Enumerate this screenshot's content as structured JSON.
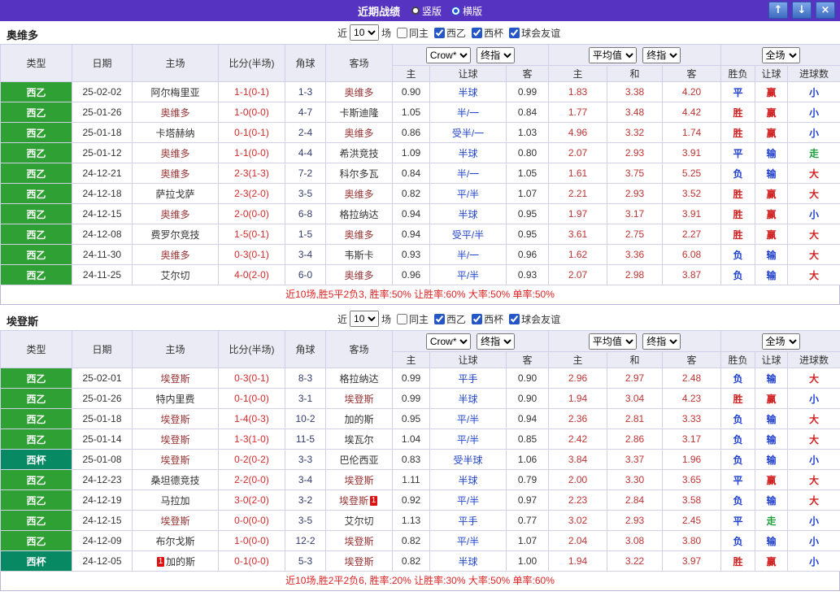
{
  "titlebar": {
    "title": "近期战绩",
    "radios": [
      {
        "label": "竖版",
        "selected": false
      },
      {
        "label": "横版",
        "selected": true
      }
    ],
    "window_buttons": {
      "up": "↑",
      "down": "↓",
      "close": "×"
    }
  },
  "controls": {
    "near_label": "近",
    "match_count": "10",
    "games_label": "场",
    "filters": [
      {
        "label": "同主",
        "checked": false
      },
      {
        "label": "西乙",
        "checked": true
      },
      {
        "label": "西杯",
        "checked": true
      },
      {
        "label": "球会友谊",
        "checked": true
      }
    ]
  },
  "table_headers": {
    "columns": [
      "类型",
      "日期",
      "主场",
      "比分(半场)",
      "角球",
      "客场"
    ],
    "dropdowns": {
      "company": "Crow*",
      "odds_stage": "终指",
      "average": "平均值",
      "avg_stage": "终指",
      "scope": "全场"
    },
    "odds_group": [
      "主",
      "让球",
      "客"
    ],
    "avg_group": [
      "主",
      "和",
      "客"
    ],
    "result_group": [
      "胜负",
      "让球",
      "进球数"
    ]
  },
  "colors": {
    "league": {
      "西乙": "#2fa033",
      "西杯": "#078a63"
    },
    "subject_team": "#993333",
    "results": {
      "胜": "#d02222",
      "平": "#1f3fcf",
      "负": "#1f3fcf",
      "赢": "#d02222",
      "输": "#1f3fcf",
      "走": "#1e9e3e",
      "大": "#d02222",
      "小": "#1f3fcf"
    }
  },
  "sections": [
    {
      "team": "奥维多",
      "summary": "近10场,胜5平2负3, 胜率:50% 让胜率:60% 大率:50% 单率:50%",
      "rows": [
        {
          "league": "西乙",
          "date": "25-02-02",
          "home": "阿尔梅里亚",
          "score": "1-1(0-1)",
          "corner": "1-3",
          "away": "奥维多",
          "odds": [
            "0.90",
            "半球",
            "0.99"
          ],
          "avg": [
            "1.83",
            "3.38",
            "4.20"
          ],
          "result": [
            "平",
            "赢",
            "小"
          ]
        },
        {
          "league": "西乙",
          "date": "25-01-26",
          "home": "奥维多",
          "score": "1-0(0-0)",
          "corner": "4-7",
          "away": "卡斯迪隆",
          "odds": [
            "1.05",
            "半/一",
            "0.84"
          ],
          "avg": [
            "1.77",
            "3.48",
            "4.42"
          ],
          "result": [
            "胜",
            "赢",
            "小"
          ]
        },
        {
          "league": "西乙",
          "date": "25-01-18",
          "home": "卡塔赫纳",
          "score": "0-1(0-1)",
          "corner": "2-4",
          "away": "奥维多",
          "odds": [
            "0.86",
            "受半/一",
            "1.03"
          ],
          "avg": [
            "4.96",
            "3.32",
            "1.74"
          ],
          "result": [
            "胜",
            "赢",
            "小"
          ]
        },
        {
          "league": "西乙",
          "date": "25-01-12",
          "home": "奥维多",
          "score": "1-1(0-0)",
          "corner": "4-4",
          "away": "希洪竞技",
          "odds": [
            "1.09",
            "半球",
            "0.80"
          ],
          "avg": [
            "2.07",
            "2.93",
            "3.91"
          ],
          "result": [
            "平",
            "输",
            "走"
          ]
        },
        {
          "league": "西乙",
          "date": "24-12-21",
          "home": "奥维多",
          "score": "2-3(1-3)",
          "corner": "7-2",
          "away": "科尔多瓦",
          "odds": [
            "0.84",
            "半/一",
            "1.05"
          ],
          "avg": [
            "1.61",
            "3.75",
            "5.25"
          ],
          "result": [
            "负",
            "输",
            "大"
          ]
        },
        {
          "league": "西乙",
          "date": "24-12-18",
          "home": "萨拉戈萨",
          "score": "2-3(2-0)",
          "corner": "3-5",
          "away": "奥维多",
          "odds": [
            "0.82",
            "平/半",
            "1.07"
          ],
          "avg": [
            "2.21",
            "2.93",
            "3.52"
          ],
          "result": [
            "胜",
            "赢",
            "大"
          ]
        },
        {
          "league": "西乙",
          "date": "24-12-15",
          "home": "奥维多",
          "score": "2-0(0-0)",
          "corner": "6-8",
          "away": "格拉纳达",
          "odds": [
            "0.94",
            "半球",
            "0.95"
          ],
          "avg": [
            "1.97",
            "3.17",
            "3.91"
          ],
          "result": [
            "胜",
            "赢",
            "小"
          ]
        },
        {
          "league": "西乙",
          "date": "24-12-08",
          "home": "费罗尔竞技",
          "score": "1-5(0-1)",
          "corner": "1-5",
          "away": "奥维多",
          "odds": [
            "0.94",
            "受平/半",
            "0.95"
          ],
          "avg": [
            "3.61",
            "2.75",
            "2.27"
          ],
          "result": [
            "胜",
            "赢",
            "大"
          ]
        },
        {
          "league": "西乙",
          "date": "24-11-30",
          "home": "奥维多",
          "score": "0-3(0-1)",
          "corner": "3-4",
          "away": "韦斯卡",
          "odds": [
            "0.93",
            "半/一",
            "0.96"
          ],
          "avg": [
            "1.62",
            "3.36",
            "6.08"
          ],
          "result": [
            "负",
            "输",
            "大"
          ]
        },
        {
          "league": "西乙",
          "date": "24-11-25",
          "home": "艾尔切",
          "score": "4-0(2-0)",
          "corner": "6-0",
          "away": "奥维多",
          "odds": [
            "0.96",
            "平/半",
            "0.93"
          ],
          "avg": [
            "2.07",
            "2.98",
            "3.87"
          ],
          "result": [
            "负",
            "输",
            "大"
          ]
        }
      ]
    },
    {
      "team": "埃登斯",
      "summary": "近10场,胜2平2负6, 胜率:20% 让胜率:30% 大率:50% 单率:60%",
      "rows": [
        {
          "league": "西乙",
          "date": "25-02-01",
          "home": "埃登斯",
          "score": "0-3(0-1)",
          "corner": "8-3",
          "away": "格拉纳达",
          "odds": [
            "0.99",
            "平手",
            "0.90"
          ],
          "avg": [
            "2.96",
            "2.97",
            "2.48"
          ],
          "result": [
            "负",
            "输",
            "大"
          ]
        },
        {
          "league": "西乙",
          "date": "25-01-26",
          "home": "特内里费",
          "score": "0-1(0-0)",
          "corner": "3-1",
          "away": "埃登斯",
          "odds": [
            "0.99",
            "半球",
            "0.90"
          ],
          "avg": [
            "1.94",
            "3.04",
            "4.23"
          ],
          "result": [
            "胜",
            "赢",
            "小"
          ]
        },
        {
          "league": "西乙",
          "date": "25-01-18",
          "home": "埃登斯",
          "score": "1-4(0-3)",
          "corner": "10-2",
          "away": "加的斯",
          "odds": [
            "0.95",
            "平/半",
            "0.94"
          ],
          "avg": [
            "2.36",
            "2.81",
            "3.33"
          ],
          "result": [
            "负",
            "输",
            "大"
          ]
        },
        {
          "league": "西乙",
          "date": "25-01-14",
          "home": "埃登斯",
          "score": "1-3(1-0)",
          "corner": "11-5",
          "away": "埃瓦尔",
          "odds": [
            "1.04",
            "平/半",
            "0.85"
          ],
          "avg": [
            "2.42",
            "2.86",
            "3.17"
          ],
          "result": [
            "负",
            "输",
            "大"
          ]
        },
        {
          "league": "西杯",
          "date": "25-01-08",
          "home": "埃登斯",
          "score": "0-2(0-2)",
          "corner": "3-3",
          "away": "巴伦西亚",
          "odds": [
            "0.83",
            "受半球",
            "1.06"
          ],
          "avg": [
            "3.84",
            "3.37",
            "1.96"
          ],
          "result": [
            "负",
            "输",
            "小"
          ]
        },
        {
          "league": "西乙",
          "date": "24-12-23",
          "home": "桑坦德竞技",
          "score": "2-2(0-0)",
          "corner": "3-4",
          "away": "埃登斯",
          "odds": [
            "1.11",
            "半球",
            "0.79"
          ],
          "avg": [
            "2.00",
            "3.30",
            "3.65"
          ],
          "result": [
            "平",
            "赢",
            "大"
          ]
        },
        {
          "league": "西乙",
          "date": "24-12-19",
          "home": "马拉加",
          "score": "3-0(2-0)",
          "corner": "3-2",
          "away": "埃登斯",
          "away_badge": {
            "text": "1",
            "pos": "after"
          },
          "odds": [
            "0.92",
            "平/半",
            "0.97"
          ],
          "avg": [
            "2.23",
            "2.84",
            "3.58"
          ],
          "result": [
            "负",
            "输",
            "大"
          ]
        },
        {
          "league": "西乙",
          "date": "24-12-15",
          "home": "埃登斯",
          "score": "0-0(0-0)",
          "corner": "3-5",
          "away": "艾尔切",
          "odds": [
            "1.13",
            "平手",
            "0.77"
          ],
          "avg": [
            "3.02",
            "2.93",
            "2.45"
          ],
          "result": [
            "平",
            "走",
            "小"
          ]
        },
        {
          "league": "西乙",
          "date": "24-12-09",
          "home": "布尔戈斯",
          "score": "1-0(0-0)",
          "corner": "12-2",
          "away": "埃登斯",
          "odds": [
            "0.82",
            "平/半",
            "1.07"
          ],
          "avg": [
            "2.04",
            "3.08",
            "3.80"
          ],
          "result": [
            "负",
            "输",
            "小"
          ]
        },
        {
          "league": "西杯",
          "date": "24-12-05",
          "home": "加的斯",
          "home_badge": {
            "text": "1",
            "pos": "before"
          },
          "score": "0-1(0-0)",
          "corner": "5-3",
          "away": "埃登斯",
          "odds": [
            "0.82",
            "半球",
            "1.00"
          ],
          "avg": [
            "1.94",
            "3.22",
            "3.97"
          ],
          "result": [
            "胜",
            "赢",
            "小"
          ]
        }
      ]
    }
  ]
}
